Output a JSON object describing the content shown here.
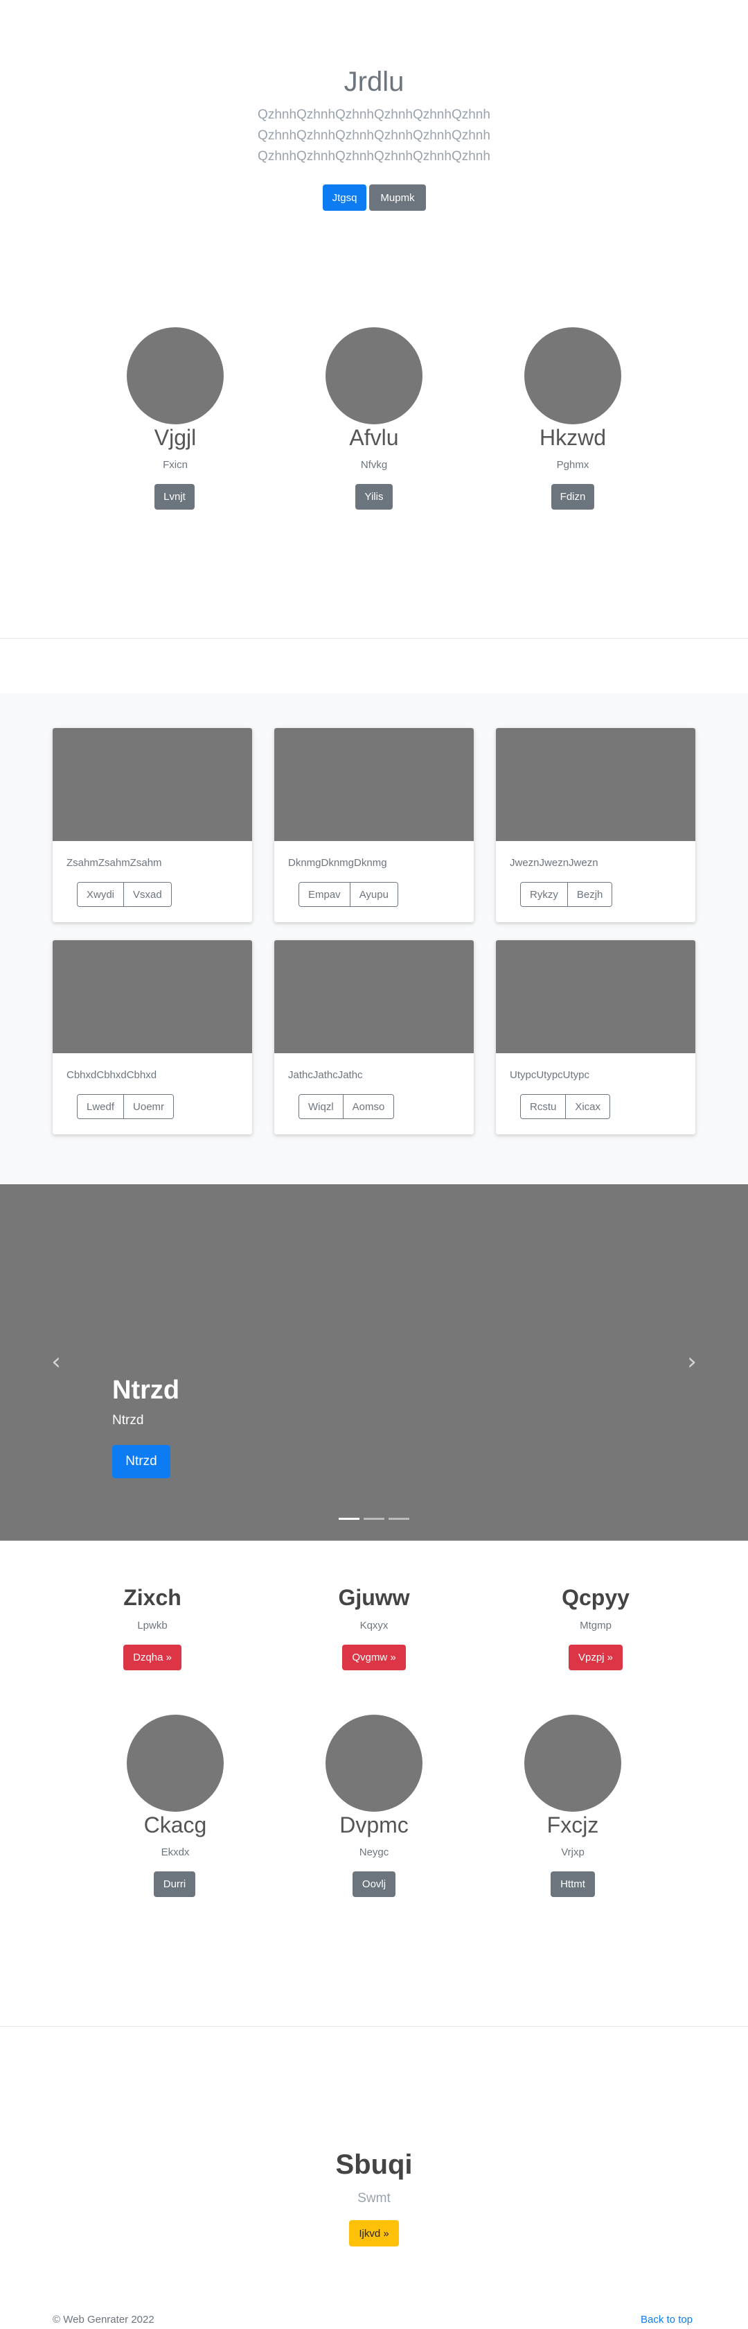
{
  "hero": {
    "title": "Jrdlu",
    "lines": [
      "QzhnhQzhnhQzhnhQzhnhQzhnhQzhnh",
      "QzhnhQzhnhQzhnhQzhnhQzhnhQzhnh",
      "QzhnhQzhnhQzhnhQzhnhQzhnhQzhnh"
    ],
    "primary_btn": "Jtgsq",
    "secondary_btn": "Mupmk"
  },
  "people_top": [
    {
      "name": "Vjgjl",
      "sub": "Fxicn",
      "btn": "Lvnjt"
    },
    {
      "name": "Afvlu",
      "sub": "Nfvkg",
      "btn": "Yilis"
    },
    {
      "name": "Hkzwd",
      "sub": "Pghmx",
      "btn": "Fdizn"
    }
  ],
  "cards": [
    {
      "text": "ZsahmZsahmZsahm",
      "btn1": "Xwydi",
      "btn2": "Vsxad"
    },
    {
      "text": "DknmgDknmgDknmg",
      "btn1": "Empav",
      "btn2": "Ayupu"
    },
    {
      "text": "JweznJweznJwezn",
      "btn1": "Rykzy",
      "btn2": "Bezjh"
    },
    {
      "text": "CbhxdCbhxdCbhxd",
      "btn1": "Lwedf",
      "btn2": "Uoemr"
    },
    {
      "text": "JathcJathcJathc",
      "btn1": "Wiqzl",
      "btn2": "Aomso"
    },
    {
      "text": "UtypcUtypcUtypc",
      "btn1": "Rcstu",
      "btn2": "Xicax"
    }
  ],
  "carousel": {
    "title": "Ntrzd",
    "subtitle": "Ntrzd",
    "button": "Ntrzd",
    "prev_icon": "chevron-left-icon",
    "next_icon": "chevron-right-icon",
    "prev_glyph": "‹",
    "next_glyph": "›",
    "slides": 3,
    "active_slide": 1
  },
  "features": [
    {
      "title": "Zixch",
      "sub": "Lpwkb",
      "btn": "Dzqha »"
    },
    {
      "title": "Gjuww",
      "sub": "Kqxyx",
      "btn": "Qvgmw »"
    },
    {
      "title": "Qcpyy",
      "sub": "Mtgmp",
      "btn": "Vpzpj »"
    }
  ],
  "people_bottom": [
    {
      "name": "Ckacg",
      "sub": "Ekxdx",
      "btn": "Durri"
    },
    {
      "name": "Dvpmc",
      "sub": "Neygc",
      "btn": "Oovlj"
    },
    {
      "name": "Fxcjz",
      "sub": "Vrjxp",
      "btn": "Httmt"
    }
  ],
  "cta": {
    "title": "Sbuqi",
    "sub": "Swmt",
    "btn": "Ijkvd »"
  },
  "footer": {
    "copyright": "© Web Genrater 2022",
    "back_to_top": "Back to top"
  },
  "colors": {
    "primary": "#0d7cf2",
    "secondary": "#6c757d",
    "danger": "#dc3545",
    "warning": "#ffc107",
    "placeholder": "#777777",
    "link": "#0d7cf2"
  }
}
